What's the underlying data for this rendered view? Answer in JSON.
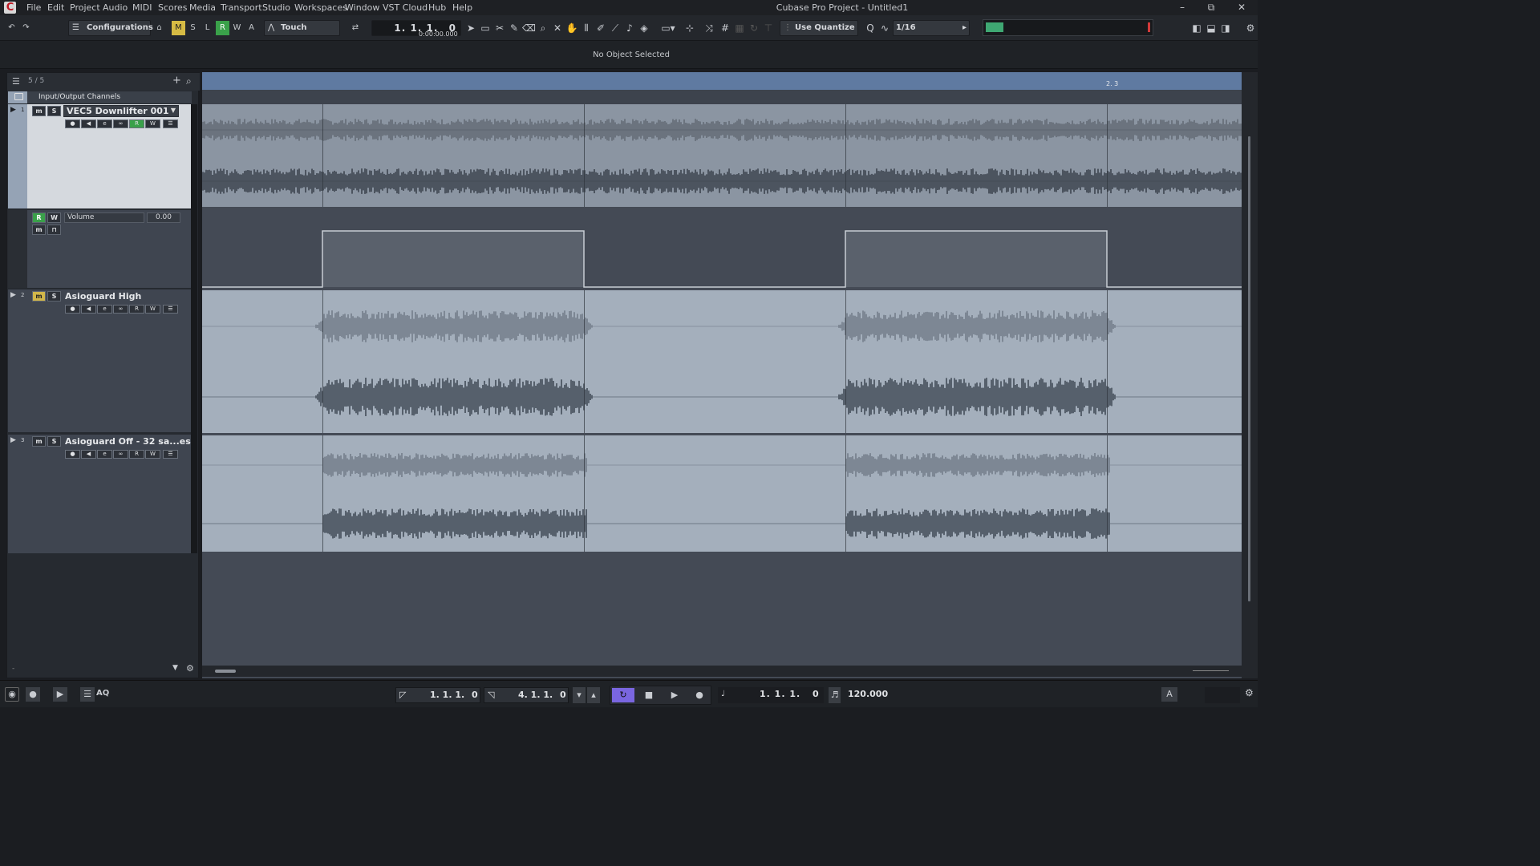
{
  "app": {
    "logo_glyph": "C",
    "title": "Cubase Pro Project - Untitled1",
    "menu": [
      "File",
      "Edit",
      "Project",
      "Audio",
      "MIDI",
      "Scores",
      "Media",
      "Transport",
      "Studio",
      "Workspaces",
      "Window",
      "VST Cloud",
      "Hub",
      "Help"
    ],
    "window_controls": {
      "minimize": "–",
      "restore": "⧉",
      "close": "✕"
    }
  },
  "toolbar": {
    "configurations_label": "Configurations",
    "state_buttons": [
      "M",
      "S",
      "L",
      "R",
      "W",
      "A"
    ],
    "automation_mode": "Touch",
    "position_bars": "1. 1. 1.",
    "position_ticks": "0",
    "position_time": "0:00:00.000",
    "quantize_label": "Use Quantize",
    "quantize_value": "1/16",
    "colors": {
      "meter_green": "#3fa873",
      "meter_peak": "#d23a3a"
    }
  },
  "info_line": {
    "text": "No Object Selected"
  },
  "track_list": {
    "count": "5 / 5",
    "folder_label": "Input/Output Channels",
    "tracks": [
      {
        "number": "1",
        "name": "VEC5 Downlifter 001",
        "mute": "m",
        "solo": "S",
        "read": "R",
        "write": "W"
      },
      {
        "number": "2",
        "name": "Asioguard High",
        "mute": "m",
        "solo": "S",
        "read": "R",
        "write": "W"
      },
      {
        "number": "3",
        "name": "Asioguard Off - 32 sa...es",
        "mute": "m",
        "solo": "S",
        "read": "R",
        "write": "W"
      }
    ],
    "automation": {
      "read": "R",
      "write": "W",
      "param": "Volume",
      "value": "0.00"
    }
  },
  "ruler": {
    "marker": "2. 3"
  },
  "transport": {
    "left_locator": "1. 1. 1.",
    "left_locator_ticks": "0",
    "right_locator": "4. 1. 1.",
    "right_locator_ticks": "0",
    "position": "1. 1. 1.",
    "position_ticks": "0",
    "tempo": "120.000",
    "aq_label": "AQ"
  }
}
